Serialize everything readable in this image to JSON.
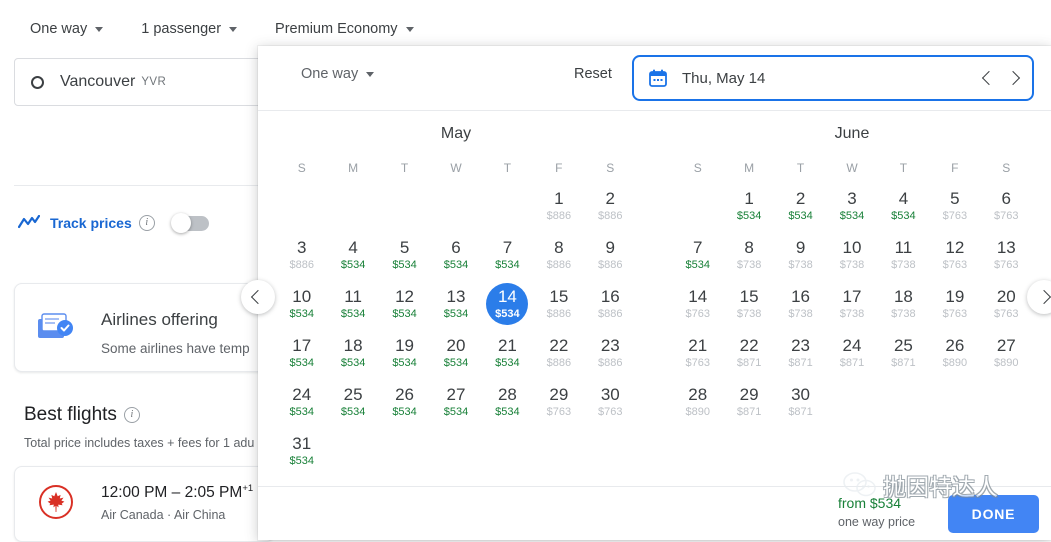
{
  "topbar": {
    "items": [
      {
        "label": "One way",
        "name": "trip-type-dropdown"
      },
      {
        "label": "1 passenger",
        "name": "passengers-dropdown"
      },
      {
        "label": "Premium Economy",
        "name": "cabin-class-dropdown"
      }
    ]
  },
  "origin": {
    "city": "Vancouver",
    "code": "YVR"
  },
  "track_prices": {
    "label": "Track prices",
    "toggle_state": "off"
  },
  "promo": {
    "title": "Airlines offering",
    "subtitle": "Some airlines have temp"
  },
  "best_flights": {
    "heading": "Best flights",
    "subtitle": "Total price includes taxes + fees for 1 adu",
    "flight": {
      "time": "12:00 PM – 2:05 PM",
      "plus_days": "+1",
      "airlines": "Air Canada  ·  Air China"
    }
  },
  "popup": {
    "trip_type": "One way",
    "reset_label": "Reset",
    "selected_date": "Thu, May 14",
    "footer": {
      "from_price": "from $534",
      "from_sub": "one way price",
      "done_label": "DONE"
    }
  },
  "dow": [
    "S",
    "M",
    "T",
    "W",
    "T",
    "F",
    "S"
  ],
  "colors": {
    "accent_blue": "#1a73e8",
    "selected_blue": "#2b7de9",
    "cheap_green": "#188038",
    "normal_gray": "#bdc1c6",
    "done_blue": "#4285f4"
  },
  "calendar": {
    "months": [
      {
        "name": "May",
        "lead_blanks": 5,
        "days": [
          {
            "n": 1,
            "price": "$886",
            "tier": "norm"
          },
          {
            "n": 2,
            "price": "$886",
            "tier": "norm"
          },
          {
            "n": 3,
            "price": "$886",
            "tier": "norm"
          },
          {
            "n": 4,
            "price": "$534",
            "tier": "cheap"
          },
          {
            "n": 5,
            "price": "$534",
            "tier": "cheap"
          },
          {
            "n": 6,
            "price": "$534",
            "tier": "cheap"
          },
          {
            "n": 7,
            "price": "$534",
            "tier": "cheap"
          },
          {
            "n": 8,
            "price": "$886",
            "tier": "norm"
          },
          {
            "n": 9,
            "price": "$886",
            "tier": "norm"
          },
          {
            "n": 10,
            "price": "$534",
            "tier": "cheap"
          },
          {
            "n": 11,
            "price": "$534",
            "tier": "cheap"
          },
          {
            "n": 12,
            "price": "$534",
            "tier": "cheap"
          },
          {
            "n": 13,
            "price": "$534",
            "tier": "cheap"
          },
          {
            "n": 14,
            "price": "$534",
            "tier": "cheap",
            "selected": true
          },
          {
            "n": 15,
            "price": "$886",
            "tier": "norm"
          },
          {
            "n": 16,
            "price": "$886",
            "tier": "norm"
          },
          {
            "n": 17,
            "price": "$534",
            "tier": "cheap"
          },
          {
            "n": 18,
            "price": "$534",
            "tier": "cheap"
          },
          {
            "n": 19,
            "price": "$534",
            "tier": "cheap"
          },
          {
            "n": 20,
            "price": "$534",
            "tier": "cheap"
          },
          {
            "n": 21,
            "price": "$534",
            "tier": "cheap"
          },
          {
            "n": 22,
            "price": "$886",
            "tier": "norm"
          },
          {
            "n": 23,
            "price": "$886",
            "tier": "norm"
          },
          {
            "n": 24,
            "price": "$534",
            "tier": "cheap"
          },
          {
            "n": 25,
            "price": "$534",
            "tier": "cheap"
          },
          {
            "n": 26,
            "price": "$534",
            "tier": "cheap"
          },
          {
            "n": 27,
            "price": "$534",
            "tier": "cheap"
          },
          {
            "n": 28,
            "price": "$534",
            "tier": "cheap"
          },
          {
            "n": 29,
            "price": "$763",
            "tier": "norm"
          },
          {
            "n": 30,
            "price": "$763",
            "tier": "norm"
          },
          {
            "n": 31,
            "price": "$534",
            "tier": "cheap"
          }
        ]
      },
      {
        "name": "June",
        "lead_blanks": 1,
        "days": [
          {
            "n": 1,
            "price": "$534",
            "tier": "cheap"
          },
          {
            "n": 2,
            "price": "$534",
            "tier": "cheap"
          },
          {
            "n": 3,
            "price": "$534",
            "tier": "cheap"
          },
          {
            "n": 4,
            "price": "$534",
            "tier": "cheap"
          },
          {
            "n": 5,
            "price": "$763",
            "tier": "norm"
          },
          {
            "n": 6,
            "price": "$763",
            "tier": "norm"
          },
          {
            "n": 7,
            "price": "$534",
            "tier": "cheap"
          },
          {
            "n": 8,
            "price": "$738",
            "tier": "norm"
          },
          {
            "n": 9,
            "price": "$738",
            "tier": "norm"
          },
          {
            "n": 10,
            "price": "$738",
            "tier": "norm"
          },
          {
            "n": 11,
            "price": "$738",
            "tier": "norm"
          },
          {
            "n": 12,
            "price": "$763",
            "tier": "norm"
          },
          {
            "n": 13,
            "price": "$763",
            "tier": "norm"
          },
          {
            "n": 14,
            "price": "$763",
            "tier": "norm"
          },
          {
            "n": 15,
            "price": "$738",
            "tier": "norm"
          },
          {
            "n": 16,
            "price": "$738",
            "tier": "norm"
          },
          {
            "n": 17,
            "price": "$738",
            "tier": "norm"
          },
          {
            "n": 18,
            "price": "$738",
            "tier": "norm"
          },
          {
            "n": 19,
            "price": "$763",
            "tier": "norm"
          },
          {
            "n": 20,
            "price": "$763",
            "tier": "norm"
          },
          {
            "n": 21,
            "price": "$763",
            "tier": "norm"
          },
          {
            "n": 22,
            "price": "$871",
            "tier": "norm"
          },
          {
            "n": 23,
            "price": "$871",
            "tier": "norm"
          },
          {
            "n": 24,
            "price": "$871",
            "tier": "norm"
          },
          {
            "n": 25,
            "price": "$871",
            "tier": "norm"
          },
          {
            "n": 26,
            "price": "$890",
            "tier": "norm"
          },
          {
            "n": 27,
            "price": "$890",
            "tier": "norm"
          },
          {
            "n": 28,
            "price": "$890",
            "tier": "norm"
          },
          {
            "n": 29,
            "price": "$871",
            "tier": "norm"
          },
          {
            "n": 30,
            "price": "$871",
            "tier": "norm"
          }
        ]
      }
    ]
  },
  "watermark": {
    "text": "抛因特达人"
  }
}
